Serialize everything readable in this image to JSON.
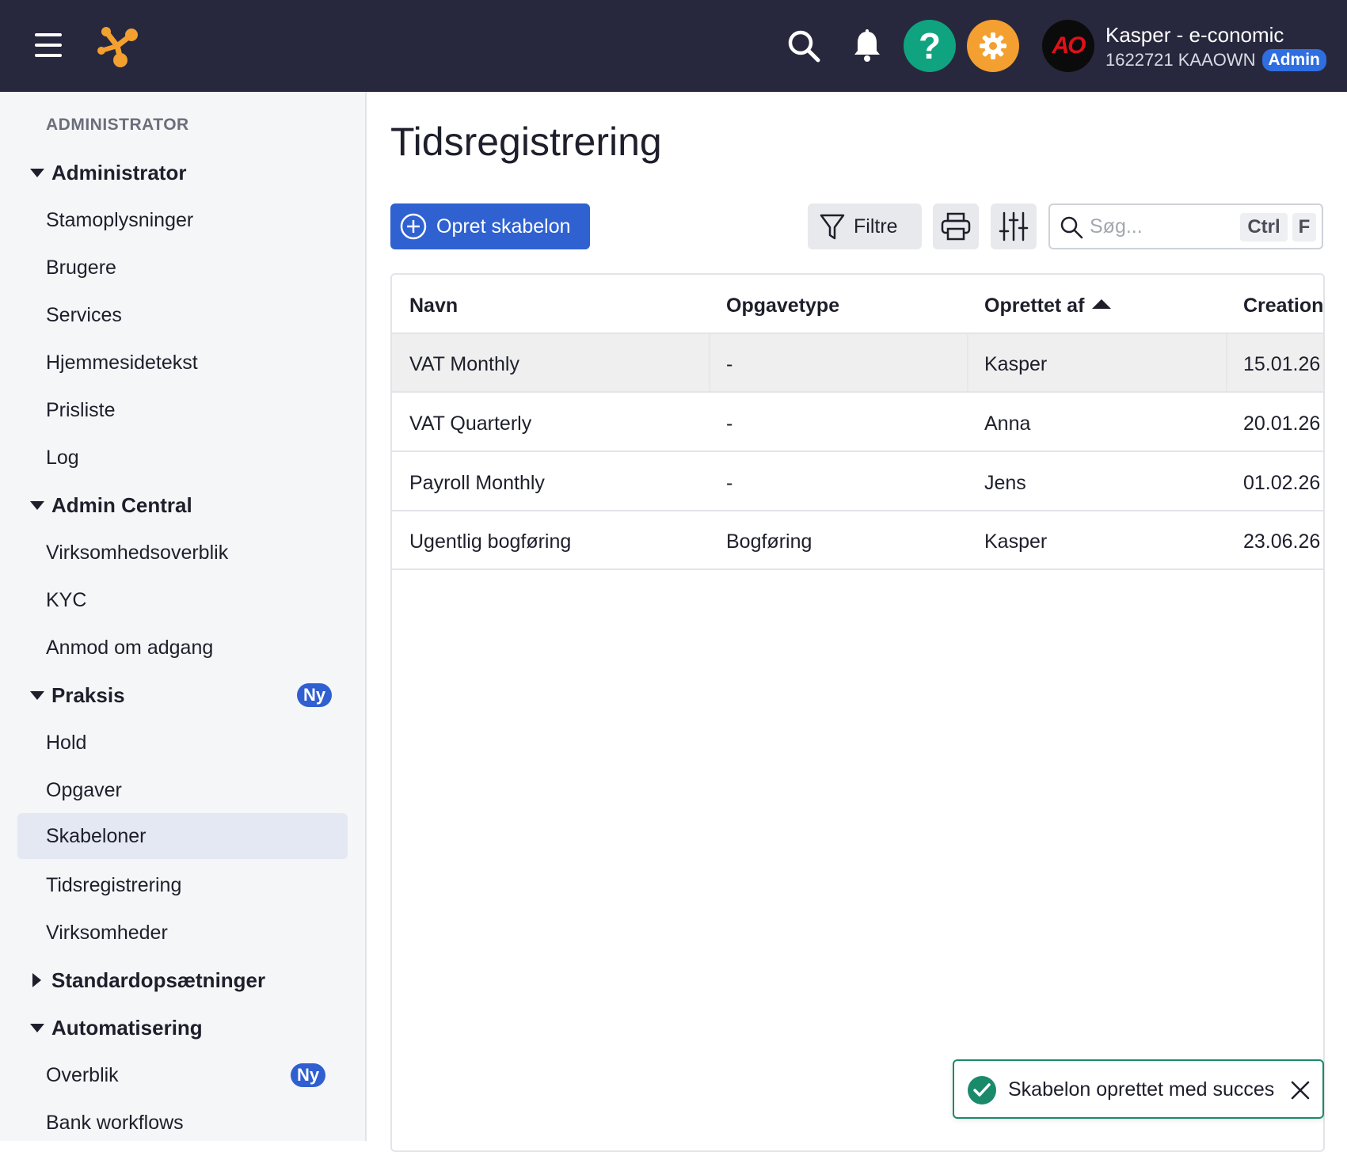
{
  "topbar": {
    "user_name": "Kasper - e-conomic",
    "user_sub": "1622721 KAAOWN",
    "role_badge": "Admin",
    "avatar_text": "AO",
    "help_glyph": "?",
    "colors": {
      "bar": "#27283d",
      "help": "#0fa37f",
      "settings": "#f3a030",
      "logo": "#f3a030"
    },
    "icons": [
      "menu-icon",
      "logo-icon",
      "search-icon",
      "bell-icon",
      "question-icon",
      "gear-icon"
    ]
  },
  "sidebar": {
    "section_label": "ADMINISTRATOR",
    "items": [
      {
        "label": "Administrator",
        "type": "group",
        "expanded": true
      },
      {
        "label": "Stamoplysninger"
      },
      {
        "label": "Brugere"
      },
      {
        "label": "Services"
      },
      {
        "label": "Hjemmesidetekst"
      },
      {
        "label": "Prisliste"
      },
      {
        "label": "Log"
      },
      {
        "label": "Admin Central",
        "type": "group",
        "expanded": true
      },
      {
        "label": "Virksomhedsoverblik"
      },
      {
        "label": "KYC"
      },
      {
        "label": "Anmod om adgang"
      },
      {
        "label": "Praksis",
        "type": "group",
        "expanded": true,
        "badge": "Ny"
      },
      {
        "label": "Hold"
      },
      {
        "label": "Opgaver"
      },
      {
        "label": "Skabeloner",
        "active": true
      },
      {
        "label": "Tidsregistrering"
      },
      {
        "label": "Virksomheder"
      },
      {
        "label": "Standardopsætninger",
        "type": "group",
        "expanded": false
      },
      {
        "label": "Automatisering",
        "type": "group",
        "expanded": true
      },
      {
        "label": "Overblik",
        "badge": "Ny"
      },
      {
        "label": "Bank workflows"
      }
    ]
  },
  "main": {
    "title": "Tidsregistrering",
    "create_button": "Opret skabelon",
    "filter_button": "Filtre",
    "search": {
      "placeholder": "Søg...",
      "value": "",
      "shortcut_ctrl": "Ctrl",
      "shortcut_key": "F"
    },
    "table": {
      "columns": [
        "Navn",
        "Opgavetype",
        "Oprettet af",
        "Creation"
      ],
      "sort_column": "Oprettet af",
      "sort_direction": "ascending",
      "rows": [
        [
          "VAT Monthly",
          "-",
          "Kasper",
          "15.01.26"
        ],
        [
          "VAT Quarterly",
          "-",
          "Anna",
          "20.01.26"
        ],
        [
          "Payroll Monthly",
          "-",
          "Jens",
          "01.02.26"
        ],
        [
          "Ugentlig bogføring",
          "Bogføring",
          "Kasper",
          "23.06.26"
        ]
      ]
    }
  },
  "toast": {
    "message": "Skabelon oprettet med succes",
    "status_color": "#1a8a6a"
  }
}
